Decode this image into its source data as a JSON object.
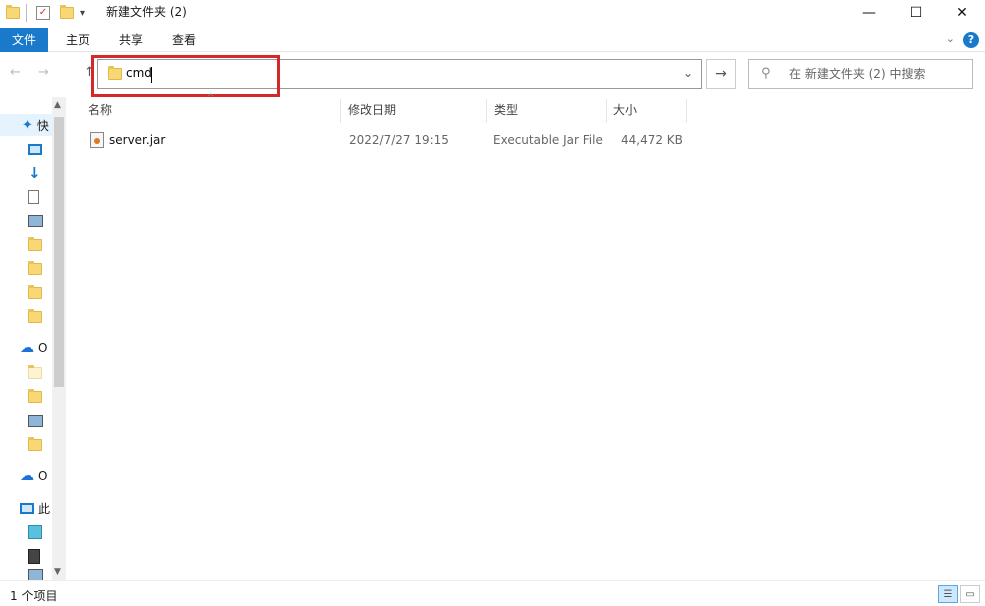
{
  "window": {
    "title": "新建文件夹 (2)",
    "minimize_glyph": "—",
    "maximize_glyph": "☐",
    "close_glyph": "✕"
  },
  "quick_access": {
    "dropdown_glyph": "▾"
  },
  "ribbon": {
    "tabs": [
      "文件",
      "主页",
      "共享",
      "查看"
    ],
    "help_glyph": "?",
    "collapse_glyph": "⌄"
  },
  "address": {
    "value": "cmd",
    "dropdown_glyph": "⌄",
    "go_glyph": "→",
    "back_glyph": "←",
    "forward_glyph": "→",
    "up_glyph": "↑"
  },
  "search": {
    "placeholder": "在 新建文件夹 (2) 中搜索",
    "icon": "search-icon"
  },
  "columns": {
    "name": "名称",
    "modified": "修改日期",
    "type": "类型",
    "size": "大小"
  },
  "files": [
    {
      "name": "server.jar",
      "modified": "2022/7/27 19:15",
      "type": "Executable Jar File",
      "size": "44,472 KB",
      "icon": "jar-file-icon"
    }
  ],
  "nav_pane": {
    "quick_access_label": "快",
    "onedrive_label_1": "O",
    "onedrive_label_2": "O",
    "this_pc_label": "此"
  },
  "status": {
    "item_count": "1 个项目"
  },
  "colors": {
    "accent": "#1979ca",
    "highlight_box": "#d62828"
  }
}
